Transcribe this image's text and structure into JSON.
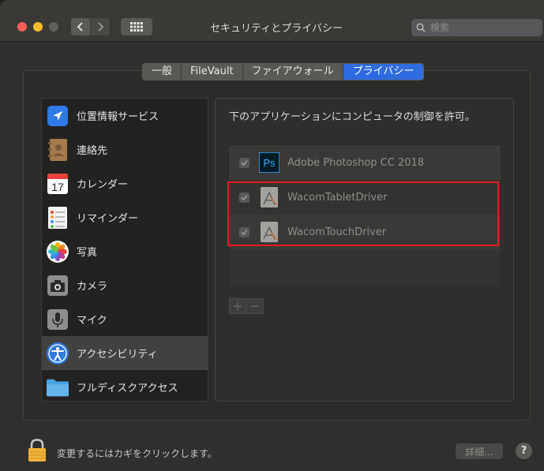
{
  "window": {
    "title": "セキュリティとプライバシー"
  },
  "search": {
    "placeholder": "検索"
  },
  "tabs": [
    {
      "label": "一般",
      "active": false
    },
    {
      "label": "FileVault",
      "active": false
    },
    {
      "label": "ファイアウォール",
      "active": false
    },
    {
      "label": "プライバシー",
      "active": true
    }
  ],
  "sidebar": {
    "items": [
      {
        "label": "位置情報サービス",
        "icon": "location-arrow-icon",
        "selected": false
      },
      {
        "label": "連絡先",
        "icon": "contacts-book-icon",
        "selected": false
      },
      {
        "label": "カレンダー",
        "icon": "calendar-icon",
        "selected": false,
        "icon_text": "17"
      },
      {
        "label": "リマインダー",
        "icon": "reminders-list-icon",
        "selected": false
      },
      {
        "label": "写真",
        "icon": "photos-flower-icon",
        "selected": false
      },
      {
        "label": "カメラ",
        "icon": "camera-icon",
        "selected": false
      },
      {
        "label": "マイク",
        "icon": "microphone-icon",
        "selected": false
      },
      {
        "label": "アクセシビリティ",
        "icon": "accessibility-icon",
        "selected": true
      },
      {
        "label": "フルディスクアクセス",
        "icon": "folder-icon",
        "selected": false
      }
    ]
  },
  "main": {
    "title": "下のアプリケーションにコンピュータの制御を許可。",
    "apps": [
      {
        "name": "Adobe Photoshop CC 2018",
        "checked": true,
        "icon": "photoshop-icon",
        "icon_text": "Ps"
      },
      {
        "name": "WacomTabletDriver",
        "checked": true,
        "icon": "generic-app-icon"
      },
      {
        "name": "WacomTouchDriver",
        "checked": true,
        "icon": "generic-app-icon"
      }
    ],
    "add_label": "+",
    "remove_label": "−"
  },
  "footer": {
    "lock_text": "変更するにはカギをクリックします。",
    "advanced_label": "詳細...",
    "help_label": "?"
  },
  "colors": {
    "accent": "#2e6cdf",
    "highlight_box": "#e11c24",
    "traffic_red": "#fc5f57",
    "traffic_yellow": "#fdbc2e"
  }
}
